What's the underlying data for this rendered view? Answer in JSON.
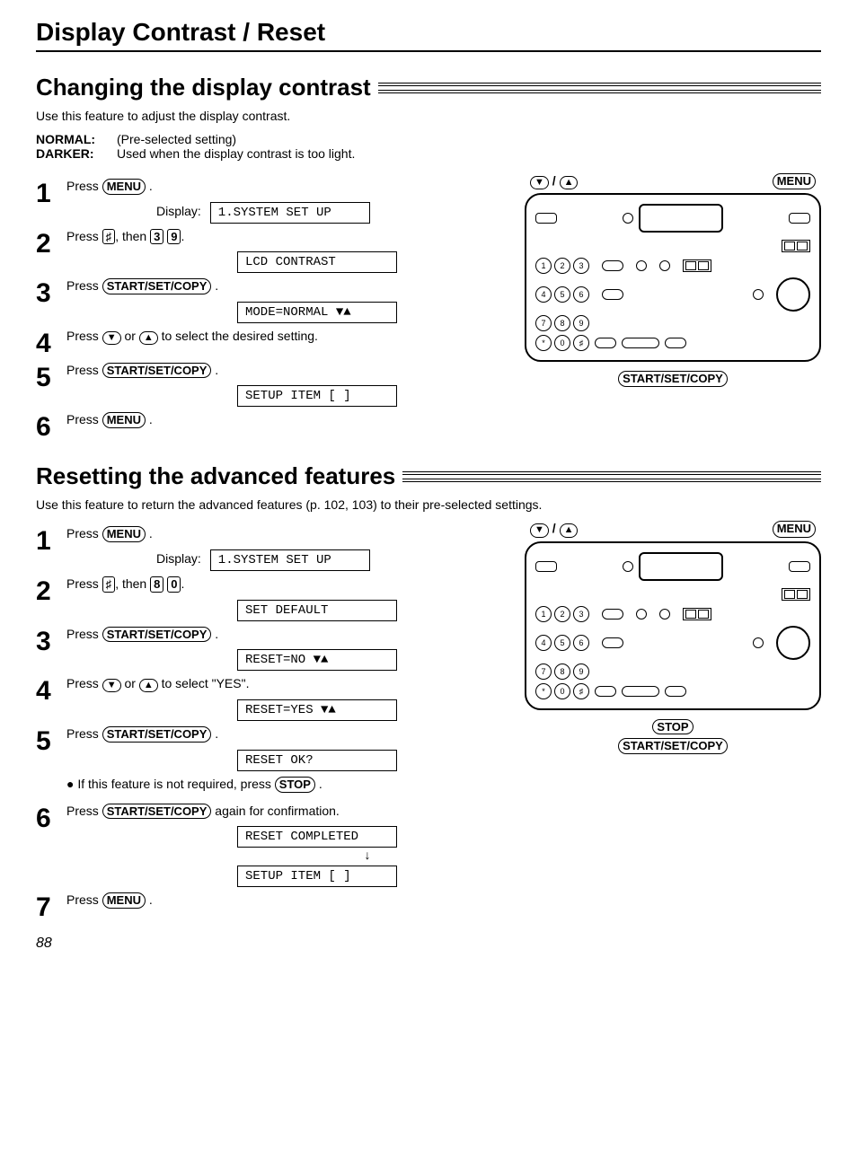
{
  "page_title": "Display Contrast / Reset",
  "page_number": "88",
  "section1": {
    "heading": "Changing the display contrast",
    "intro": "Use this feature to adjust the display contrast.",
    "defs": {
      "normal_label": "NORMAL:",
      "normal_desc": "(Pre-selected setting)",
      "darker_label": "DARKER:",
      "darker_desc": "Used when the display contrast is too light."
    },
    "steps": {
      "s1": {
        "num": "1",
        "text1": "Press ",
        "btn": "MENU",
        "text2": " ."
      },
      "display_label": "Display:",
      "lcd1": "1.SYSTEM SET UP",
      "s2": {
        "num": "2",
        "text1": "Press ",
        "key1": "♯",
        "text2": ", then ",
        "key2": "3",
        "key3": "9",
        "text3": "."
      },
      "lcd2": "LCD CONTRAST",
      "s3": {
        "num": "3",
        "text1": "Press ",
        "btn": "START/SET/COPY",
        "text2": " ."
      },
      "lcd3": "MODE=NORMAL   ▼▲",
      "s4": {
        "num": "4",
        "text1": "Press ",
        "btnDown": "▼",
        "text2": " or ",
        "btnUp": "▲",
        "text3": " to select the desired setting."
      },
      "s5": {
        "num": "5",
        "text1": "Press ",
        "btn": "START/SET/COPY",
        "text2": " ."
      },
      "lcd5": "SETUP ITEM [  ]",
      "s6": {
        "num": "6",
        "text1": "Press ",
        "btn": "MENU",
        "text2": " ."
      }
    },
    "illus": {
      "arrows_label": "▼ / ▲",
      "menu_label": "MENU",
      "callout": "START/SET/COPY"
    }
  },
  "section2": {
    "heading": "Resetting the advanced features",
    "intro": "Use this feature to return the advanced features (p. 102, 103) to their pre-selected settings.",
    "steps": {
      "s1": {
        "num": "1",
        "text1": "Press ",
        "btn": "MENU",
        "text2": " ."
      },
      "display_label": "Display:",
      "lcd1": "1.SYSTEM SET UP",
      "s2": {
        "num": "2",
        "text1": "Press ",
        "key1": "♯",
        "text2": ", then ",
        "key2": "8",
        "key3": "0",
        "text3": "."
      },
      "lcd2": "SET DEFAULT",
      "s3": {
        "num": "3",
        "text1": "Press ",
        "btn": "START/SET/COPY",
        "text2": " ."
      },
      "lcd3": "RESET=NO     ▼▲",
      "s4": {
        "num": "4",
        "text1": "Press ",
        "btnDown": "▼",
        "text2": " or ",
        "btnUp": "▲",
        "text3": " to select \"YES\"."
      },
      "lcd4": "RESET=YES    ▼▲",
      "s5": {
        "num": "5",
        "text1": "Press ",
        "btn": "START/SET/COPY",
        "text2": " ."
      },
      "lcd5": "RESET OK?",
      "bullet": {
        "text1": "● If this feature is not required, press ",
        "btn": "STOP",
        "text2": " ."
      },
      "s6": {
        "num": "6",
        "text1": "Press ",
        "btn": "START/SET/COPY",
        "text2": " again for confirmation."
      },
      "lcd6a": "RESET COMPLETED",
      "arrow": "↓",
      "lcd6b": "SETUP ITEM [  ]",
      "s7": {
        "num": "7",
        "text1": "Press ",
        "btn": "MENU",
        "text2": " ."
      }
    },
    "illus": {
      "arrows_label": "▼ / ▲",
      "menu_label": "MENU",
      "callout_stop": "STOP",
      "callout_start": "START/SET/COPY"
    }
  }
}
